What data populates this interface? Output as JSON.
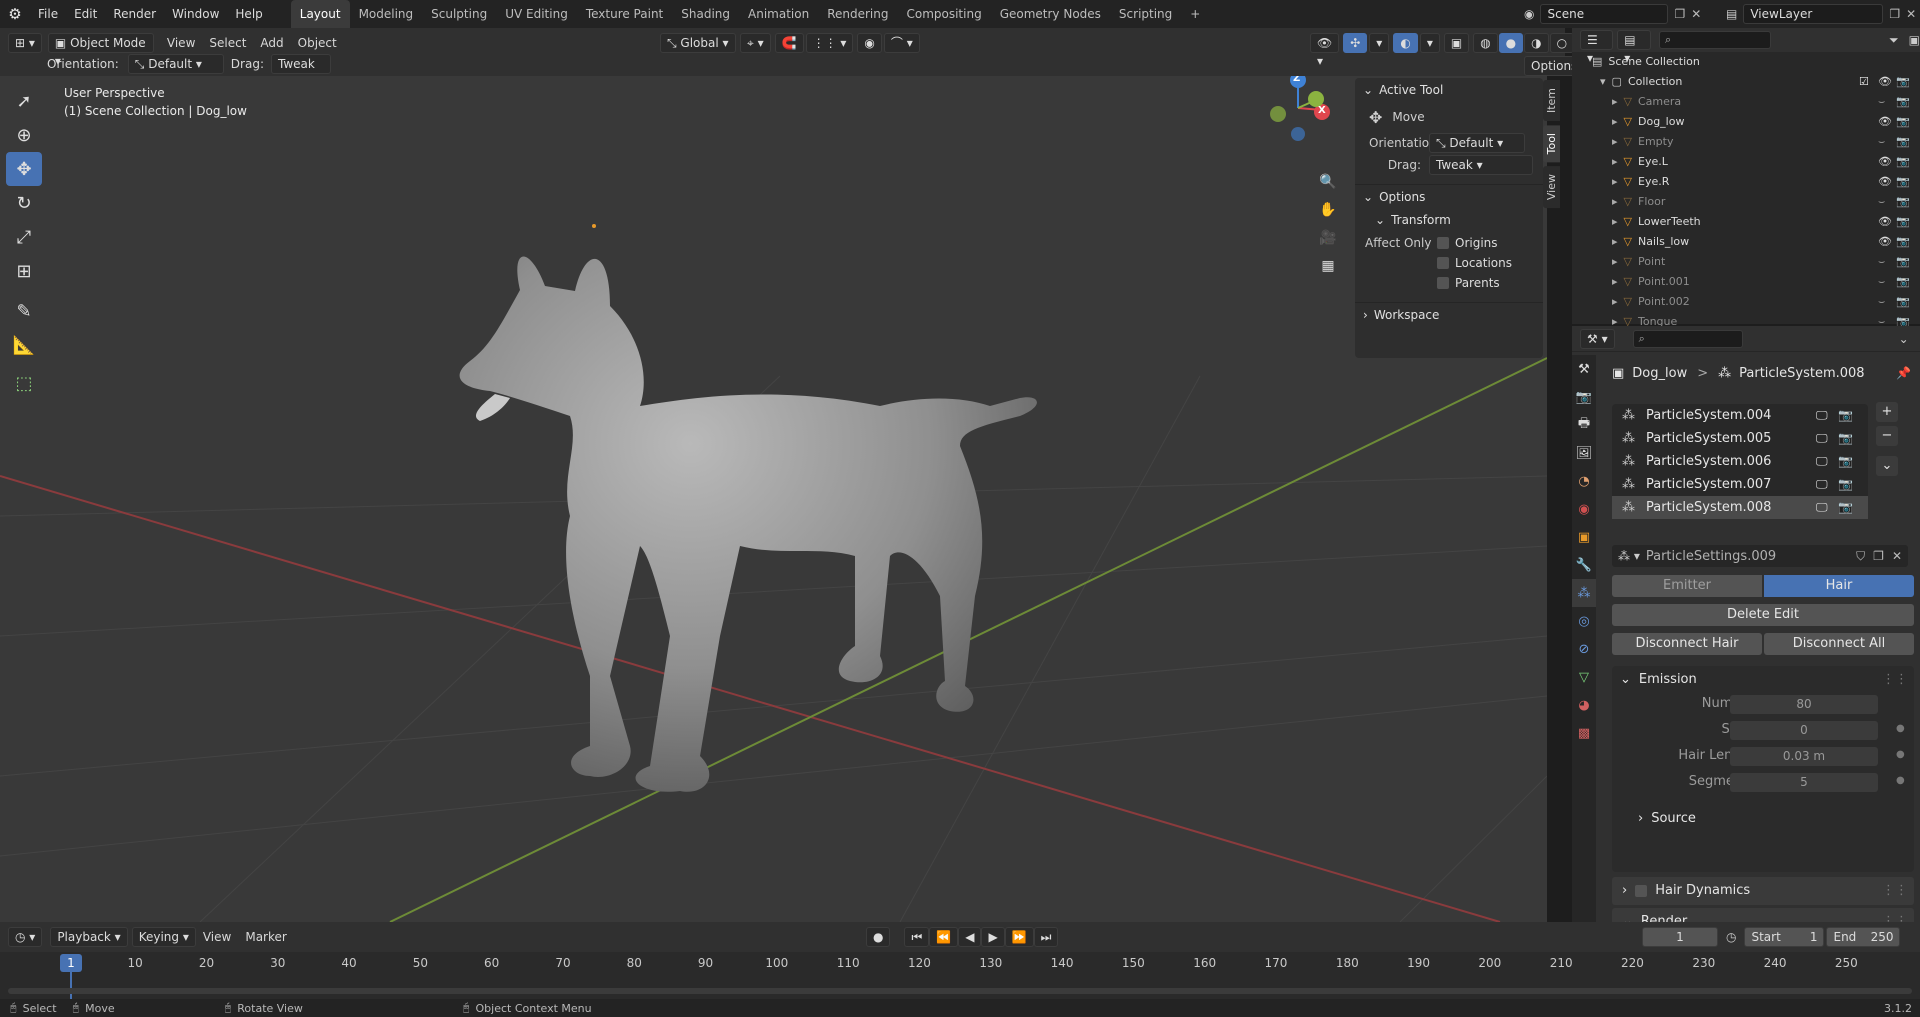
{
  "topbar": {
    "menus": [
      "File",
      "Edit",
      "Render",
      "Window",
      "Help"
    ],
    "workspaces": [
      "Layout",
      "Modeling",
      "Sculpting",
      "UV Editing",
      "Texture Paint",
      "Shading",
      "Animation",
      "Rendering",
      "Compositing",
      "Geometry Nodes",
      "Scripting"
    ],
    "active_workspace": "Layout",
    "add_tab": "+",
    "scene": "Scene",
    "view_layer": "ViewLayer"
  },
  "viewport_header": {
    "mode": "Object Mode",
    "menus": [
      "View",
      "Select",
      "Add",
      "Object"
    ],
    "transform_orientation": "Global",
    "options": "Options",
    "orientation_label": "Orientation:",
    "orientation_value": "Default",
    "drag_label": "Drag:",
    "drag_value": "Tweak"
  },
  "viewport": {
    "perspective": "User Perspective",
    "collection_info": "(1) Scene Collection | Dog_low",
    "gizmo": {
      "x": "X",
      "y": "Y",
      "z": "Z"
    }
  },
  "npanel": {
    "tabs": [
      "Item",
      "Tool",
      "View"
    ],
    "active_tool_title": "Active Tool",
    "tool_name": "Move",
    "orientation_label": "Orientation",
    "orientation_value": "Default",
    "drag_label": "Drag:",
    "drag_value": "Tweak",
    "options_title": "Options",
    "transform_title": "Transform",
    "affect_only_label": "Affect Only",
    "affect_origins": "Origins",
    "affect_locations": "Locations",
    "affect_parents": "Parents",
    "workspace_title": "Workspace"
  },
  "outliner": {
    "root": "Scene Collection",
    "collection": "Collection",
    "items": [
      {
        "name": "Camera",
        "dim": true
      },
      {
        "name": "Dog_low",
        "dim": false
      },
      {
        "name": "Empty",
        "dim": true
      },
      {
        "name": "Eye.L",
        "dim": false
      },
      {
        "name": "Eye.R",
        "dim": false
      },
      {
        "name": "Floor",
        "dim": true
      },
      {
        "name": "LowerTeeth",
        "dim": false
      },
      {
        "name": "Nails_low",
        "dim": false
      },
      {
        "name": "Point",
        "dim": true
      },
      {
        "name": "Point.001",
        "dim": true
      },
      {
        "name": "Point.002",
        "dim": true
      },
      {
        "name": "Tongue",
        "dim": true
      }
    ]
  },
  "properties": {
    "breadcrumb_object": "Dog_low",
    "breadcrumb_sep": ">",
    "breadcrumb_system": "ParticleSystem.008",
    "particle_systems": [
      "ParticleSystem.004",
      "ParticleSystem.005",
      "ParticleSystem.006",
      "ParticleSystem.007",
      "ParticleSystem.008"
    ],
    "selected_system": "ParticleSystem.008",
    "settings_name": "ParticleSettings.009",
    "type_emitter": "Emitter",
    "type_hair": "Hair",
    "delete_edit": "Delete Edit",
    "disconnect_hair": "Disconnect Hair",
    "disconnect_all": "Disconnect All",
    "emission_title": "Emission",
    "number_label": "Number",
    "number_value": "80",
    "seed_label": "Seed",
    "seed_value": "0",
    "hair_length_label": "Hair Length",
    "hair_length_value": "0.03 m",
    "segments_label": "Segments",
    "segments_value": "5",
    "source_title": "Source",
    "hair_dynamics_title": "Hair Dynamics",
    "render_title": "Render"
  },
  "timeline": {
    "menus": [
      "Playback",
      "Keying",
      "View",
      "Marker"
    ],
    "current_frame": "1",
    "start_label": "Start",
    "start_value": "1",
    "end_label": "End",
    "end_value": "250",
    "ticks": [
      "10",
      "20",
      "30",
      "40",
      "50",
      "60",
      "70",
      "80",
      "90",
      "100",
      "110",
      "120",
      "130",
      "140",
      "150",
      "160",
      "170",
      "180",
      "190",
      "200",
      "210",
      "220",
      "230",
      "240",
      "250"
    ],
    "playhead": "1"
  },
  "statusbar": {
    "select": "Select",
    "move": "Move",
    "rotate_view": "Rotate View",
    "context_menu": "Object Context Menu",
    "version": "3.1.2"
  },
  "colors": {
    "accent": "#4772b3",
    "x_axis": "#e0464e",
    "y_axis": "#8bb340",
    "z_axis": "#3f82d6"
  }
}
